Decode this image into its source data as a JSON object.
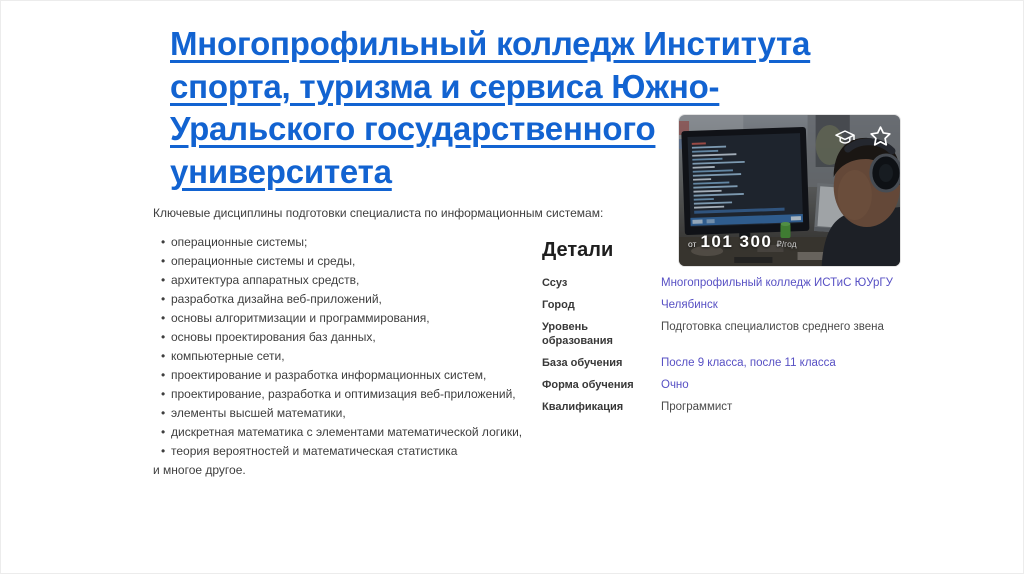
{
  "title": {
    "text": "Многопрофильный колледж Института спорта, туризма и сервиса Южно-Уральского государственного университета"
  },
  "content": {
    "intro": "Ключевые дисциплины подготовки специалиста по информационным системам:",
    "disciplines": [
      "операционные системы;",
      "операционные системы и среды,",
      "архитектура аппаратных средств,",
      "разработка дизайна веб-приложений,",
      "основы алгоритмизации и программирования,",
      "основы проектирования баз данных,",
      "компьютерные сети,",
      "проектирование и разработка информационных систем,",
      "проектирование, разработка и оптимизация веб-приложений,",
      "элементы высшей математики,",
      "дискретная математика с элементами математической логики,",
      "теория вероятностей и математическая статистика"
    ],
    "outro": "и многое другое."
  },
  "details": {
    "heading": "Детали",
    "rows": [
      {
        "label": "Ссуз",
        "value": "Многопрофильный колледж ИСТиС ЮУрГУ"
      },
      {
        "label": "Город",
        "value": "Челябинск"
      },
      {
        "label": "Уровень образования",
        "value": "Подготовка специалистов среднего звена"
      },
      {
        "label": "База обучения",
        "value": "После 9 класса, после 11 класса"
      },
      {
        "label": "Форма обучения",
        "value": "Очно"
      },
      {
        "label": "Квалификация",
        "value": "Программист"
      }
    ]
  },
  "photo_card": {
    "price_prefix": "от",
    "price_value": "101 300",
    "price_suffix": "₽/год",
    "icons": [
      "graduation-cap",
      "star"
    ]
  },
  "colors": {
    "title_link": "#1263d1",
    "detail_link": "#5750c4",
    "body_text": "#3e3e3e",
    "heading_text": "#1e1e1e"
  }
}
